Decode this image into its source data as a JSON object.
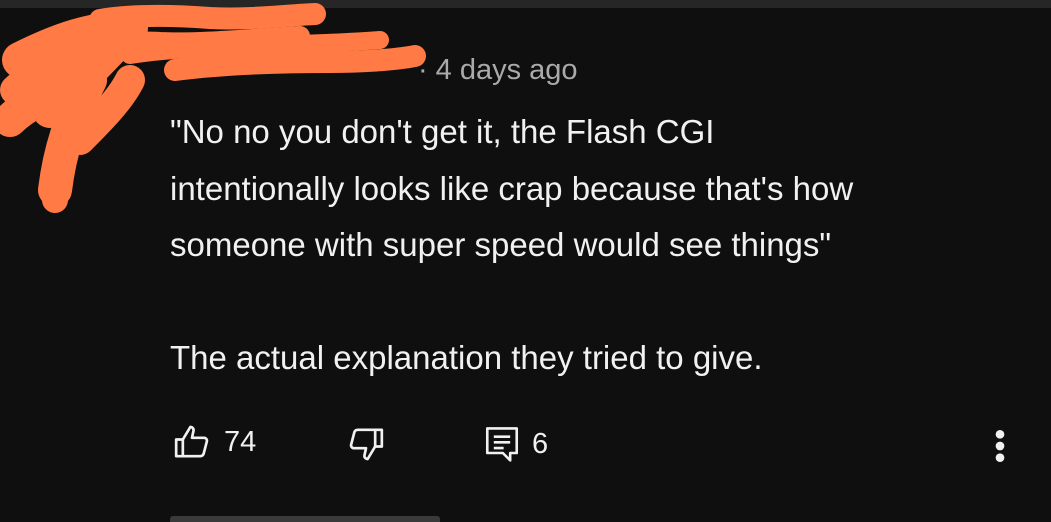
{
  "comment": {
    "author_redacted": true,
    "timestamp": "4 days ago",
    "text_lines": [
      "\"No no you don't get it, the Flash CGI",
      "intentionally looks like crap because that's how",
      "someone with super speed would see things\""
    ],
    "text_after": "The actual explanation they tried to give."
  },
  "actions": {
    "like_count": "74",
    "reply_count": "6"
  },
  "colors": {
    "background": "#0f0f0f",
    "text": "#f1f1f1",
    "meta": "#aaaaaa",
    "redaction": "#ff7a45"
  },
  "icons": [
    "thumbs-up-icon",
    "thumbs-down-icon",
    "comment-icon",
    "more-vert-icon"
  ]
}
